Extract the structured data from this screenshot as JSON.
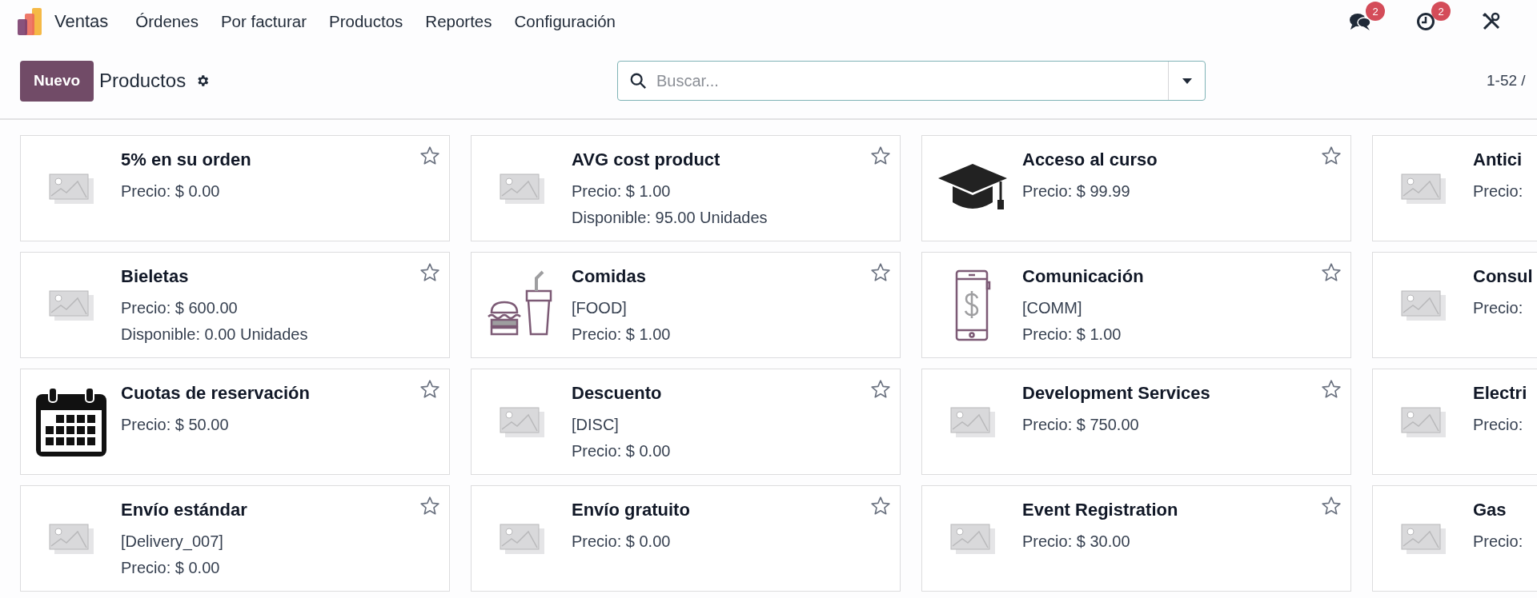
{
  "navbar": {
    "app": "Ventas",
    "menu": [
      "Órdenes",
      "Por facturar",
      "Productos",
      "Reportes",
      "Configuración"
    ],
    "messages_badge": "2",
    "activities_badge": "2"
  },
  "control_panel": {
    "new_button": "Nuevo",
    "title": "Productos",
    "search": {
      "placeholder": "Buscar..."
    },
    "pager": "1-52 /"
  },
  "products": [
    {
      "name": "5% en su orden",
      "kind": "placeholder",
      "favorite": false,
      "lines": [
        "Precio: $ 0.00"
      ]
    },
    {
      "name": "AVG cost product",
      "kind": "placeholder",
      "favorite": false,
      "lines": [
        "Precio: $ 1.00",
        "Disponible: 95.00 Unidades"
      ]
    },
    {
      "name": "Acceso al curso",
      "kind": "cap",
      "favorite": false,
      "lines": [
        "Precio: $ 99.99"
      ]
    },
    {
      "name": "Antici",
      "kind": "placeholder",
      "lines": [
        "Precio:"
      ]
    },
    {
      "name": "Bieletas",
      "kind": "placeholder",
      "favorite": false,
      "lines": [
        "Precio: $ 600.00",
        "Disponible: 0.00 Unidades"
      ]
    },
    {
      "name": "Comidas",
      "kind": "food",
      "favorite": false,
      "lines": [
        "[FOOD]",
        "Precio: $ 1.00"
      ]
    },
    {
      "name": "Comunicación",
      "kind": "phone",
      "favorite": false,
      "lines": [
        "[COMM]",
        "Precio: $ 1.00"
      ]
    },
    {
      "name": "Consul",
      "kind": "placeholder",
      "lines": [
        "Precio:"
      ]
    },
    {
      "name": "Cuotas de reservación",
      "kind": "calendar",
      "favorite": false,
      "lines": [
        "Precio: $ 50.00"
      ]
    },
    {
      "name": "Descuento",
      "kind": "placeholder",
      "favorite": false,
      "lines": [
        "[DISC]",
        "Precio: $ 0.00"
      ]
    },
    {
      "name": "Development Services",
      "kind": "placeholder",
      "favorite": false,
      "lines": [
        "Precio: $ 750.00"
      ]
    },
    {
      "name": "Electri",
      "kind": "placeholder",
      "lines": [
        "Precio:"
      ]
    },
    {
      "name": "Envío estándar",
      "kind": "placeholder",
      "favorite": false,
      "lines": [
        "[Delivery_007]",
        "Precio: $ 0.00"
      ]
    },
    {
      "name": "Envío gratuito",
      "kind": "placeholder",
      "favorite": false,
      "lines": [
        "Precio: $ 0.00"
      ]
    },
    {
      "name": "Event Registration",
      "kind": "placeholder",
      "favorite": false,
      "lines": [
        "Precio: $ 30.00"
      ]
    },
    {
      "name": "Gas",
      "kind": "placeholder",
      "lines": [
        "Precio:"
      ]
    }
  ]
}
